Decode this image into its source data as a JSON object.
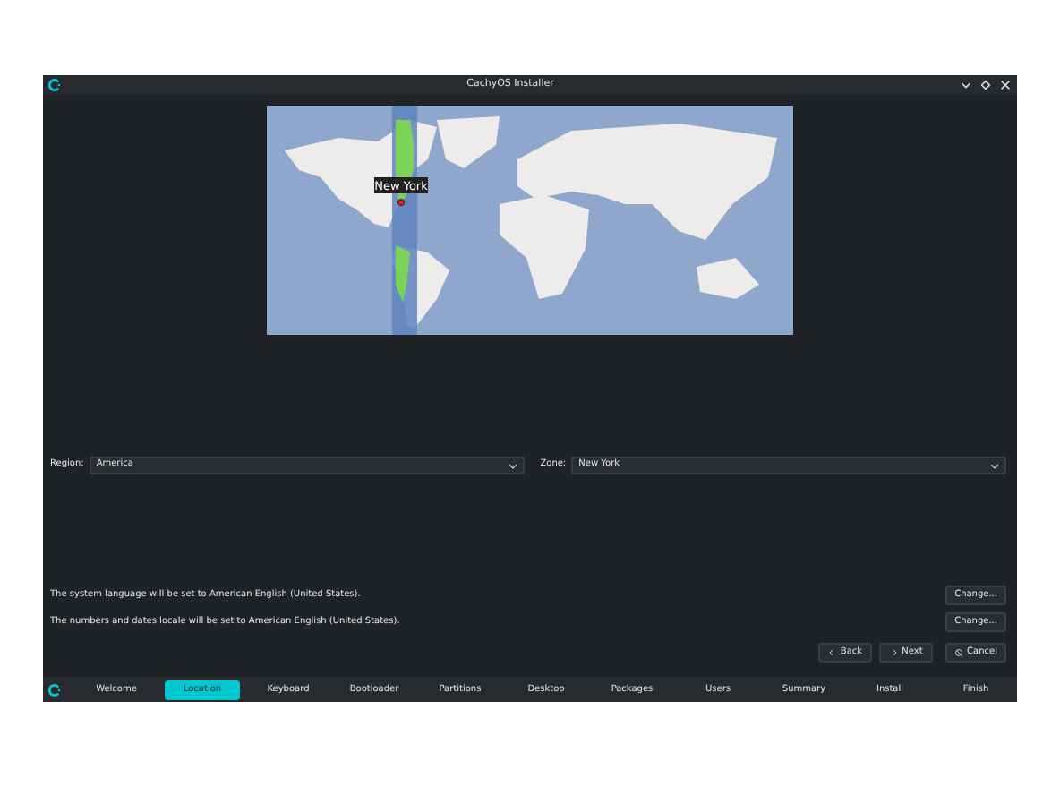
{
  "window": {
    "title": "CachyOS Installer"
  },
  "map": {
    "pin_label": "New York"
  },
  "region": {
    "label": "Region:",
    "value": "America"
  },
  "zone": {
    "label": "Zone:",
    "value": "New York"
  },
  "locale_lines": [
    {
      "text": "The system language will be set to American English (United States).",
      "button": "Change..."
    },
    {
      "text": "The numbers and dates locale will be set to American English (United States).",
      "button": "Change..."
    }
  ],
  "nav_buttons": [
    {
      "kind": "back",
      "label": "Back"
    },
    {
      "kind": "next",
      "label": "Next"
    },
    {
      "kind": "cancel",
      "label": "Cancel"
    }
  ],
  "steps": [
    {
      "label": "Welcome",
      "selected": false
    },
    {
      "label": "Location",
      "selected": true
    },
    {
      "label": "Keyboard",
      "selected": false
    },
    {
      "label": "Bootloader",
      "selected": false
    },
    {
      "label": "Partitions",
      "selected": false
    },
    {
      "label": "Desktop",
      "selected": false
    },
    {
      "label": "Packages",
      "selected": false
    },
    {
      "label": "Users",
      "selected": false
    },
    {
      "label": "Summary",
      "selected": false
    },
    {
      "label": "Install",
      "selected": false
    },
    {
      "label": "Finish",
      "selected": false
    }
  ]
}
